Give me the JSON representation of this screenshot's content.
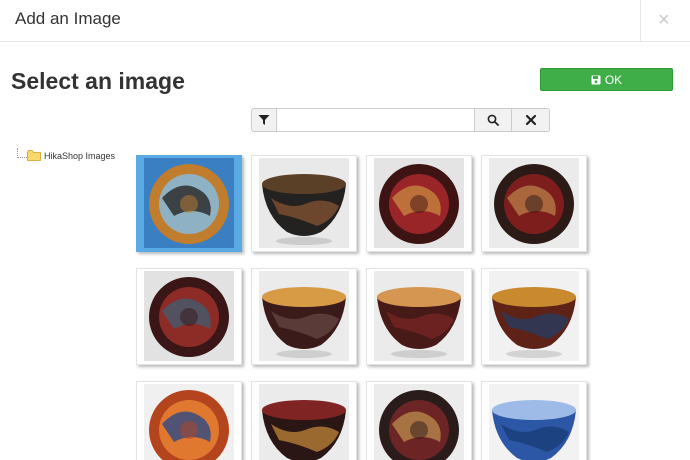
{
  "dialog": {
    "title": "Add an Image",
    "close_label": "×",
    "close_icon": "close-icon"
  },
  "page": {
    "title": "Select an image"
  },
  "ok_button": {
    "label": "OK",
    "icon": "save-icon",
    "color": "#3fae49"
  },
  "search": {
    "value": "",
    "placeholder": "",
    "filter_icon": "filter-icon",
    "search_icon": "search-icon",
    "clear_icon": "clear-icon"
  },
  "tree": {
    "folder_icon": "folder-icon",
    "root_label": "HikaShop Images"
  },
  "images": [
    {
      "type": "top",
      "selected": true,
      "bg": "#3b7fc3",
      "outer": "#c07d2d",
      "inner": "#8fb1c4",
      "accent": "#1f1c1a"
    },
    {
      "type": "side",
      "selected": false,
      "bg": "#e9e9e9",
      "outer": "#232221",
      "inner": "#5b4028",
      "accent": "#8c5533"
    },
    {
      "type": "top",
      "selected": false,
      "bg": "#e4e4e4",
      "outer": "#3d1314",
      "inner": "#9a2528",
      "accent": "#c98940"
    },
    {
      "type": "top",
      "selected": false,
      "bg": "#ebebeb",
      "outer": "#2b1a15",
      "inner": "#7d1e1d",
      "accent": "#b9804a"
    },
    {
      "type": "top",
      "selected": false,
      "bg": "#e2e2e2",
      "outer": "#3a1616",
      "inner": "#8d2c26",
      "accent": "#3e5d74"
    },
    {
      "type": "side",
      "selected": false,
      "bg": "#ebebeb",
      "outer": "#3b1a1a",
      "inner": "#d79a45",
      "accent": "#6a4a46"
    },
    {
      "type": "side",
      "selected": false,
      "bg": "#ebebeb",
      "outer": "#471a18",
      "inner": "#d49650",
      "accent": "#7d2626"
    },
    {
      "type": "side",
      "selected": false,
      "bg": "#f1f1f1",
      "outer": "#5e2316",
      "inner": "#c9892f",
      "accent": "#1f3f6b"
    },
    {
      "type": "top",
      "selected": false,
      "bg": "#f0f0f0",
      "outer": "#b3441d",
      "inner": "#e1782f",
      "accent": "#21468d"
    },
    {
      "type": "side",
      "selected": false,
      "bg": "#ebebeb",
      "outer": "#2b1616",
      "inner": "#7f2422",
      "accent": "#c98d3b"
    },
    {
      "type": "top",
      "selected": false,
      "bg": "#ececec",
      "outer": "#2a1c1b",
      "inner": "#6c2524",
      "accent": "#bc8e4c"
    },
    {
      "type": "side",
      "selected": false,
      "bg": "#f2f2f2",
      "outer": "#2c56a6",
      "inner": "#9dbbe6",
      "accent": "#173a73"
    }
  ]
}
